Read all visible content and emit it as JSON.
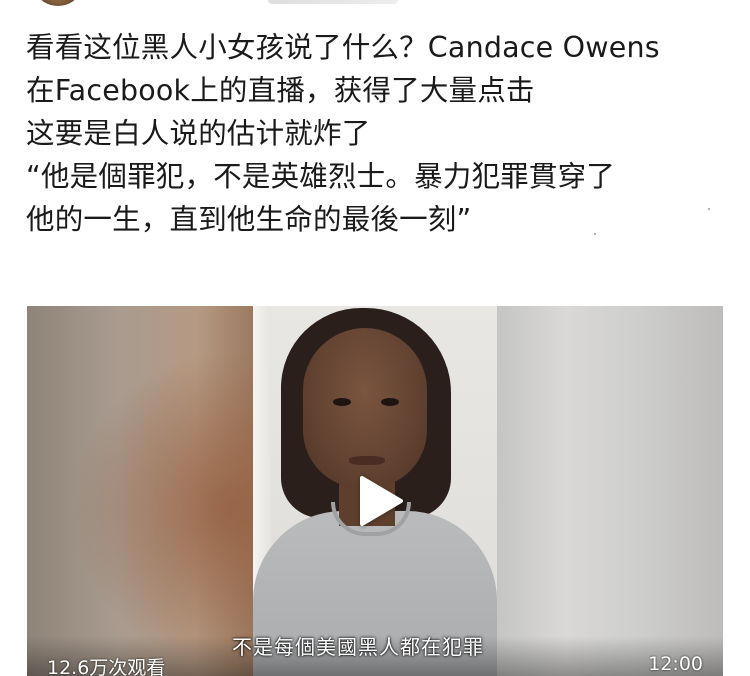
{
  "post": {
    "lines": [
      "看看这位黑人小女孩说了什么？Candace Owens",
      "在Facebook上的直播，获得了大量点击",
      "这要是白人说的估计就炸了",
      "“他是個罪犯，不是英雄烈士。暴力犯罪貫穿了",
      "他的一生，直到他生命的最後一刻”"
    ]
  },
  "video": {
    "subtitle": "不是每個美國黑人都在犯罪",
    "view_count": "12.6万次观看",
    "duration": "12:00",
    "play_icon": "play-icon"
  }
}
